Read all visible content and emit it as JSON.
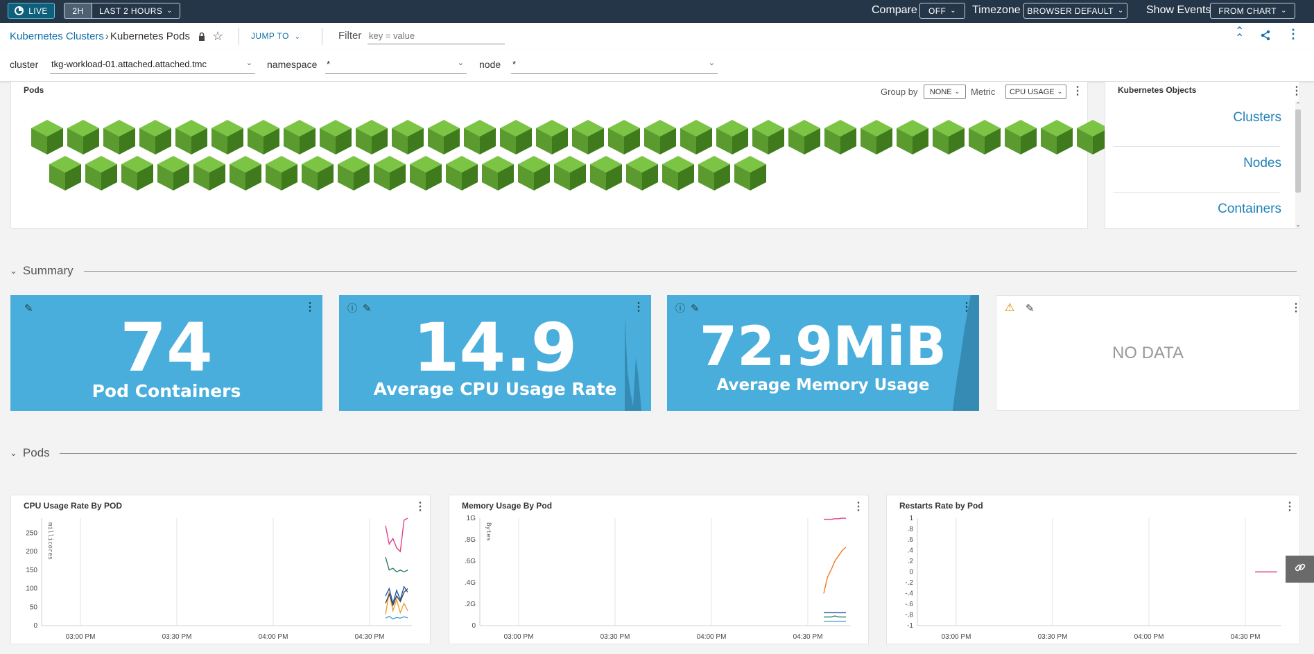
{
  "topbar": {
    "live_label": "LIVE",
    "range_short": "2H",
    "range_label": "LAST 2 HOURS",
    "compare_label": "Compare",
    "compare_value": "OFF",
    "timezone_label": "Timezone",
    "timezone_value": "BROWSER DEFAULT",
    "events_label": "Show Events",
    "events_value": "FROM CHART"
  },
  "breadcrumb": {
    "parent": "Kubernetes Clusters",
    "current": "Kubernetes Pods",
    "jump_to": "JUMP TO",
    "filter_label": "Filter",
    "filter_placeholder": "key = value"
  },
  "filters": {
    "cluster_label": "cluster",
    "cluster_value": "tkg-workload-01.attached.attached.tmc",
    "namespace_label": "namespace",
    "namespace_value": "*",
    "node_label": "node",
    "node_value": "*"
  },
  "pods_panel": {
    "title": "Pods",
    "group_by_label": "Group by",
    "group_by_value": "NONE",
    "metric_label": "Metric",
    "metric_value": "CPU USAGE",
    "pod_count": 50
  },
  "objects_panel": {
    "title": "Kubernetes Objects",
    "items": [
      "Clusters",
      "Nodes",
      "Containers"
    ]
  },
  "summary": {
    "heading": "Summary",
    "cards": [
      {
        "value": "74",
        "label": "Pod Containers"
      },
      {
        "value": "14.9",
        "label": "Average CPU Usage Rate"
      },
      {
        "value": "72.9MiB",
        "label": "Average Memory Usage"
      },
      {
        "value": "NO DATA",
        "label": ""
      }
    ]
  },
  "pods_section": {
    "heading": "Pods"
  },
  "colors": {
    "accent": "#49aedb",
    "topbar": "#243647",
    "link": "#0f6fa8",
    "cube": "#5a9a2e"
  },
  "chart_data": [
    {
      "type": "line",
      "title": "CPU Usage Rate By POD",
      "ylabel": "millicores",
      "x_ticks": [
        "03:00 PM",
        "03:30 PM",
        "04:00 PM",
        "04:30 PM"
      ],
      "y_ticks": [
        "250",
        "200",
        "150",
        "100",
        "50",
        "0"
      ],
      "ylim": [
        0,
        290
      ],
      "series": [
        {
          "color": "#e0408a",
          "x": [
            0,
            1,
            2,
            3,
            4,
            5,
            6
          ],
          "values": [
            270,
            220,
            235,
            210,
            200,
            285,
            290
          ]
        },
        {
          "color": "#2e7d5b",
          "x": [
            0,
            1,
            2,
            3,
            4,
            5,
            6
          ],
          "values": [
            185,
            150,
            155,
            145,
            150,
            145,
            150
          ]
        },
        {
          "color": "#2255aa",
          "x": [
            0,
            1,
            2,
            3,
            4,
            5,
            6
          ],
          "values": [
            80,
            100,
            60,
            95,
            70,
            105,
            90
          ]
        },
        {
          "color": "#f0a030",
          "x": [
            0,
            1,
            2,
            3,
            4,
            5,
            6
          ],
          "values": [
            30,
            90,
            40,
            70,
            35,
            60,
            40
          ]
        },
        {
          "color": "#444444",
          "x": [
            0,
            1,
            2,
            3,
            4,
            5,
            6
          ],
          "values": [
            60,
            85,
            55,
            80,
            65,
            90,
            100
          ]
        },
        {
          "color": "#4aa0d8",
          "x": [
            0,
            1,
            2,
            3,
            4,
            5,
            6
          ],
          "values": [
            20,
            25,
            18,
            22,
            20,
            24,
            21
          ]
        }
      ]
    },
    {
      "type": "line",
      "title": "Memory Usage By Pod",
      "ylabel": "Bytes",
      "x_ticks": [
        "03:00 PM",
        "03:30 PM",
        "04:00 PM",
        "04:30 PM"
      ],
      "y_ticks": [
        "1G",
        ".8G",
        ".6G",
        ".4G",
        ".2G",
        "0"
      ],
      "ylim": [
        0,
        1
      ],
      "series": [
        {
          "color": "#e0408a",
          "x": [
            0,
            1,
            2,
            3,
            4,
            5,
            6
          ],
          "values": [
            0.99,
            0.99,
            0.99,
            0.995,
            0.995,
            1.0,
            1.0
          ]
        },
        {
          "color": "#f07820",
          "x": [
            0,
            1,
            2,
            3,
            4,
            5,
            6
          ],
          "values": [
            0.3,
            0.45,
            0.52,
            0.6,
            0.65,
            0.7,
            0.73
          ]
        },
        {
          "color": "#2255aa",
          "x": [
            0,
            1,
            2,
            3,
            4,
            5,
            6
          ],
          "values": [
            0.12,
            0.12,
            0.12,
            0.12,
            0.12,
            0.12,
            0.12
          ]
        },
        {
          "color": "#2e7d5b",
          "x": [
            0,
            1,
            2,
            3,
            4,
            5,
            6
          ],
          "values": [
            0.08,
            0.08,
            0.08,
            0.09,
            0.08,
            0.08,
            0.08
          ]
        },
        {
          "color": "#4aa0d8",
          "x": [
            0,
            1,
            2,
            3,
            4,
            5,
            6
          ],
          "values": [
            0.04,
            0.04,
            0.04,
            0.04,
            0.04,
            0.04,
            0.04
          ]
        }
      ]
    },
    {
      "type": "line",
      "title": "Restarts Rate by Pod",
      "ylabel": "",
      "x_ticks": [
        "03:00 PM",
        "03:30 PM",
        "04:00 PM",
        "04:30 PM"
      ],
      "y_ticks": [
        "1",
        ".8",
        ".6",
        ".4",
        ".2",
        "0",
        "-.2",
        "-.4",
        "-.6",
        "-.8",
        "-1"
      ],
      "ylim": [
        -1,
        1
      ],
      "series": [
        {
          "color": "#e0408a",
          "x": [
            0,
            1,
            2,
            3,
            4,
            5,
            6
          ],
          "values": [
            0,
            0,
            0,
            0,
            0,
            0,
            0
          ]
        }
      ]
    }
  ]
}
